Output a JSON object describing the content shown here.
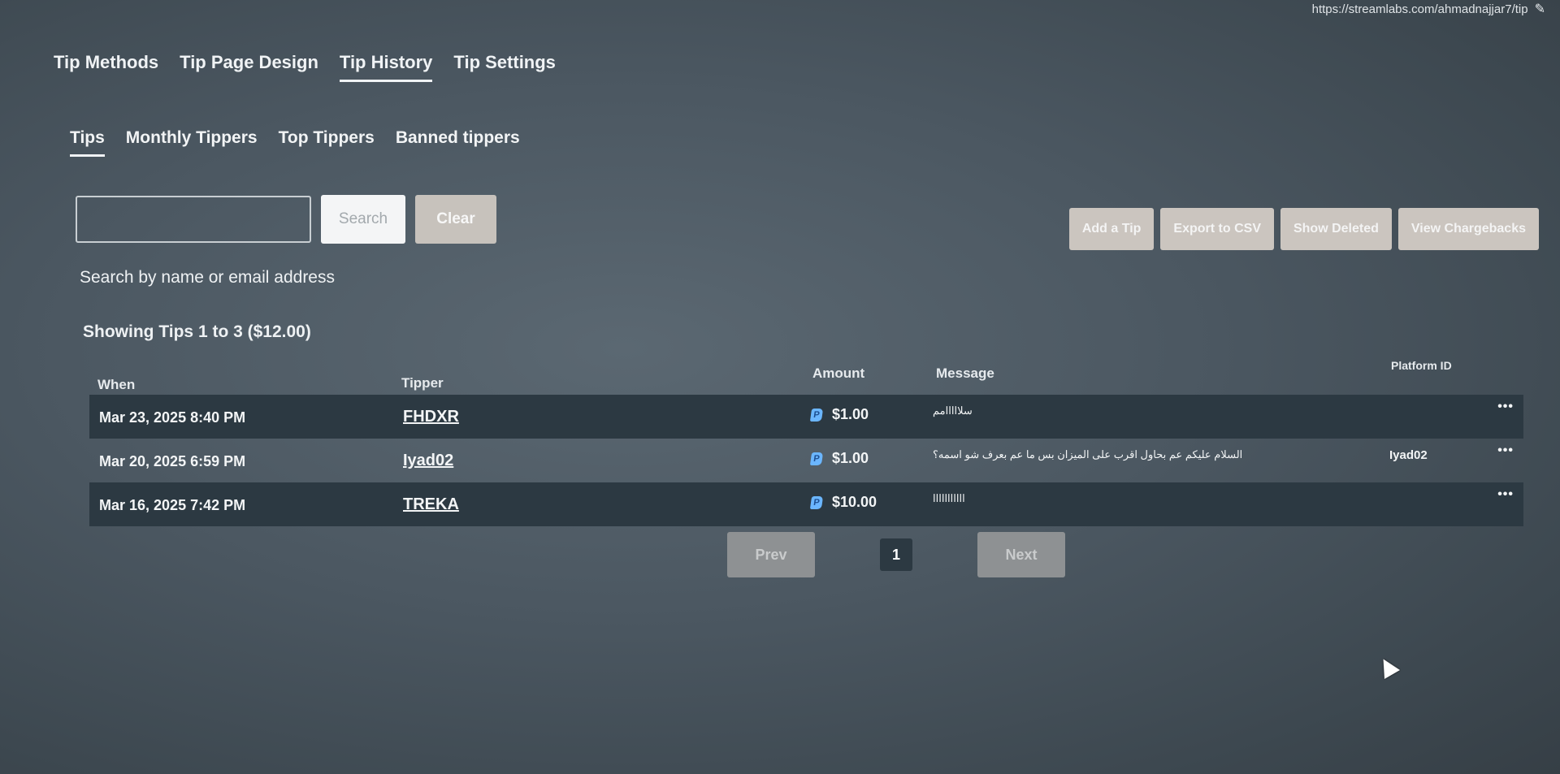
{
  "header": {
    "url": "https://streamlabs.com/ahmadnajjar7/tip",
    "edit_icon": "pencil-icon"
  },
  "main_tabs": [
    {
      "label": "Tip Methods",
      "active": false
    },
    {
      "label": "Tip Page Design",
      "active": false
    },
    {
      "label": "Tip History",
      "active": true
    },
    {
      "label": "Tip Settings",
      "active": false
    }
  ],
  "sub_tabs": [
    {
      "label": "Tips",
      "active": true
    },
    {
      "label": "Monthly Tippers",
      "active": false
    },
    {
      "label": "Top Tippers",
      "active": false
    },
    {
      "label": "Banned tippers",
      "active": false
    }
  ],
  "search": {
    "value": "",
    "button_label": "Search",
    "clear_label": "Clear",
    "hint": "Search by name or email address"
  },
  "actions": {
    "add_tip": "Add a Tip",
    "export_csv": "Export to CSV",
    "show_deleted": "Show Deleted",
    "view_chargebacks": "View Chargebacks"
  },
  "summary": "Showing Tips 1 to 3 ($12.00)",
  "table": {
    "headers": {
      "when": "When",
      "tipper": "Tipper",
      "amount": "Amount",
      "message": "Message",
      "platform_id": "Platform ID"
    },
    "rows": [
      {
        "when": "Mar 23, 2025 8:40 PM",
        "tipper": "FHDXR",
        "amount": "$1.00",
        "message": "سلااااامم",
        "platform_id": "",
        "menu": "•••"
      },
      {
        "when": "Mar 20, 2025 6:59 PM",
        "tipper": "Iyad02",
        "amount": "$1.00",
        "message": "السلام عليكم عم بحاول اقرب على الميزان بس ما عم بعرف شو اسمه؟",
        "platform_id": "Iyad02",
        "menu": "•••"
      },
      {
        "when": "Mar 16, 2025 7:42 PM",
        "tipper": "TREKA",
        "amount": "$10.00",
        "message": "ااااااااااا",
        "platform_id": "",
        "menu": "•••"
      }
    ]
  },
  "pagination": {
    "prev": "Prev",
    "page": "1",
    "next": "Next"
  },
  "colors": {
    "background": "#4b5761",
    "row_dark": "#2c3942",
    "button_muted": "#cbc5bf",
    "paypal": "#6bb6ff"
  }
}
